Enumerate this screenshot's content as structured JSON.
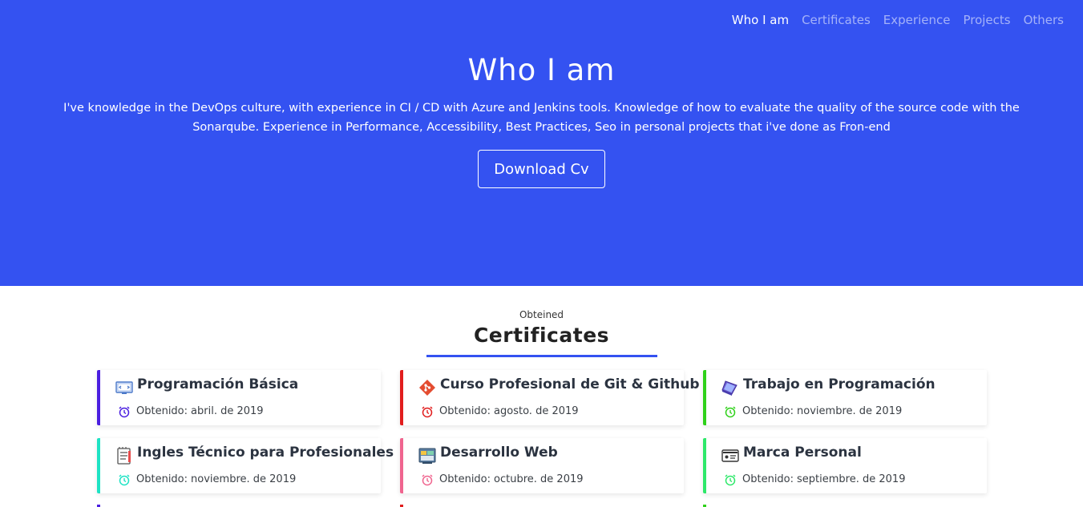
{
  "nav": {
    "items": [
      {
        "label": "Who I am",
        "active": true
      },
      {
        "label": "Certificates",
        "active": false
      },
      {
        "label": "Experience",
        "active": false
      },
      {
        "label": "Projects",
        "active": false
      },
      {
        "label": "Others",
        "active": false
      }
    ]
  },
  "hero": {
    "title": "Who I am",
    "description": "I've knowledge in the DevOps culture, with experience in CI / CD with Azure and Jenkins tools. Knowledge of how to evaluate the quality of the source code with the Sonarqube. Experience in Performance, Accessibility, Best Practices, Seo in personal projects that i've done as Fron-end",
    "cv_button": "Download Cv",
    "background": "#3452f1"
  },
  "certificates": {
    "subtitle": "Obteined",
    "title": "Certificates",
    "date_prefix": "Obtenido:",
    "items": [
      {
        "title": "Programación Básica",
        "date": "abril. de 2019",
        "accent": "#4b1fe0",
        "icon": "computer-code-icon"
      },
      {
        "title": "Curso Profesional de Git & Github",
        "date": "agosto. de 2019",
        "accent": "#e11d1d",
        "icon": "git-logo-icon"
      },
      {
        "title": "Trabajo en Programación",
        "date": "noviembre. de 2019",
        "accent": "#2fd11a",
        "icon": "laptop-icon"
      },
      {
        "title": "Ingles Técnico para Profesionales",
        "date": "noviembre. de 2019",
        "accent": "#1ee3c4",
        "icon": "notepad-icon"
      },
      {
        "title": "Desarrollo Web",
        "date": "octubre. de 2019",
        "accent": "#f0658f",
        "icon": "web-window-icon"
      },
      {
        "title": "Marca Personal",
        "date": "septiembre. de 2019",
        "accent": "#2ee86a",
        "icon": "id-card-icon"
      }
    ]
  }
}
